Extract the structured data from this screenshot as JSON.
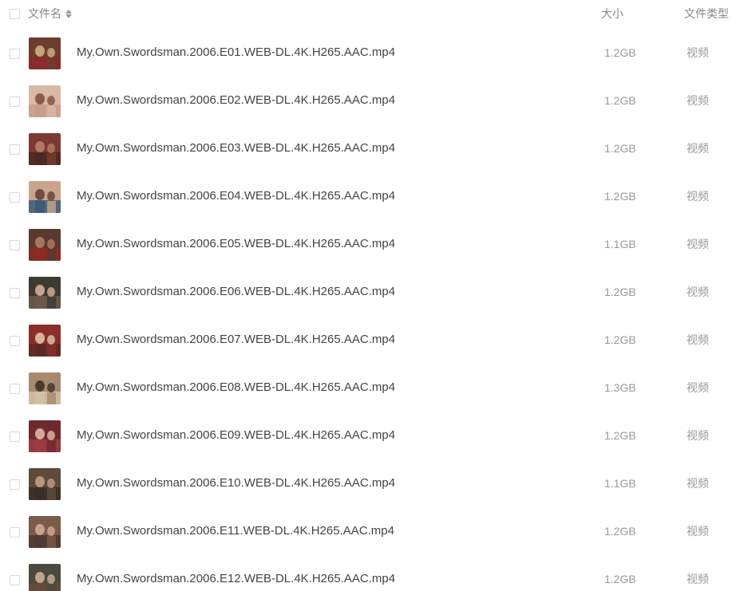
{
  "header": {
    "name_label": "文件名",
    "size_label": "大小",
    "type_label": "文件类型",
    "sort_icon": "sort-updown-icon"
  },
  "files": [
    {
      "name": "My.Own.Swordsman.2006.E01.WEB-DL.4K.H265.AAC.mp4",
      "size": "1.2GB",
      "type": "视频",
      "thumb_colors": [
        "#6b3d2e",
        "#c9a27a",
        "#8a2a2a"
      ]
    },
    {
      "name": "My.Own.Swordsman.2006.E02.WEB-DL.4K.H265.AAC.mp4",
      "size": "1.2GB",
      "type": "视频",
      "thumb_colors": [
        "#d9b9a6",
        "#8c5a4a",
        "#c79d8a"
      ]
    },
    {
      "name": "My.Own.Swordsman.2006.E03.WEB-DL.4K.H265.AAC.mp4",
      "size": "1.2GB",
      "type": "视频",
      "thumb_colors": [
        "#7a3a32",
        "#b07862",
        "#4a2a22"
      ]
    },
    {
      "name": "My.Own.Swordsman.2006.E04.WEB-DL.4K.H265.AAC.mp4",
      "size": "1.2GB",
      "type": "视频",
      "thumb_colors": [
        "#caa58c",
        "#6e4d3e",
        "#3f5a78"
      ]
    },
    {
      "name": "My.Own.Swordsman.2006.E05.WEB-DL.4K.H265.AAC.mp4",
      "size": "1.1GB",
      "type": "视频",
      "thumb_colors": [
        "#5a3a30",
        "#a8755c",
        "#8c2c24"
      ]
    },
    {
      "name": "My.Own.Swordsman.2006.E06.WEB-DL.4K.H265.AAC.mp4",
      "size": "1.2GB",
      "type": "视频",
      "thumb_colors": [
        "#3d3a34",
        "#c4a48c",
        "#6b5a4a"
      ]
    },
    {
      "name": "My.Own.Swordsman.2006.E07.WEB-DL.4K.H265.AAC.mp4",
      "size": "1.2GB",
      "type": "视频",
      "thumb_colors": [
        "#8a2e2a",
        "#d8b49a",
        "#5a2a22"
      ]
    },
    {
      "name": "My.Own.Swordsman.2006.E08.WEB-DL.4K.H265.AAC.mp4",
      "size": "1.3GB",
      "type": "视频",
      "thumb_colors": [
        "#a88a6e",
        "#4a3a2e",
        "#d2c0a8"
      ]
    },
    {
      "name": "My.Own.Swordsman.2006.E09.WEB-DL.4K.H265.AAC.mp4",
      "size": "1.2GB",
      "type": "视频",
      "thumb_colors": [
        "#6e2a2e",
        "#d6a89a",
        "#9c3c44"
      ]
    },
    {
      "name": "My.Own.Swordsman.2006.E10.WEB-DL.4K.H265.AAC.mp4",
      "size": "1.1GB",
      "type": "视频",
      "thumb_colors": [
        "#5e4a3a",
        "#b89478",
        "#3a2e26"
      ]
    },
    {
      "name": "My.Own.Swordsman.2006.E11.WEB-DL.4K.H265.AAC.mp4",
      "size": "1.2GB",
      "type": "视频",
      "thumb_colors": [
        "#7a5a48",
        "#c8a288",
        "#4e3a30"
      ]
    },
    {
      "name": "My.Own.Swordsman.2006.E12.WEB-DL.4K.H265.AAC.mp4",
      "size": "1.2GB",
      "type": "视频",
      "thumb_colors": [
        "#4a4a3e",
        "#c0a48e",
        "#6a4a3a"
      ]
    }
  ]
}
